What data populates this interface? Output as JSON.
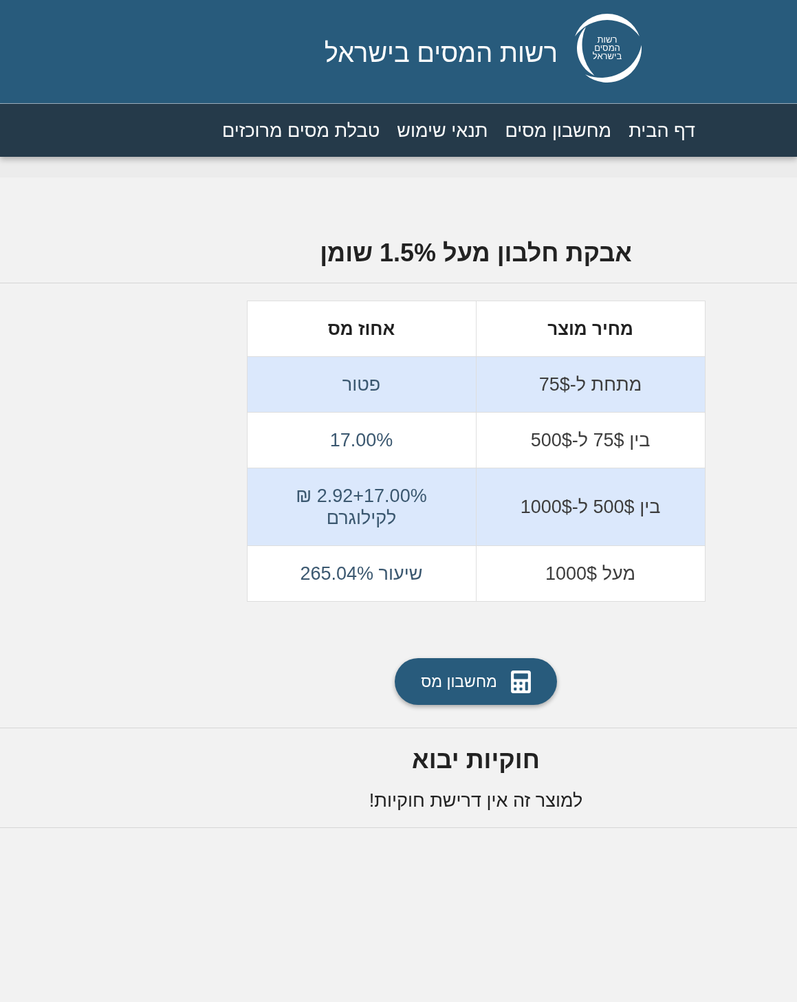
{
  "header": {
    "logo_text": [
      "רשות",
      "המסים",
      "בישראל"
    ],
    "title": "רשות המסים בישראל"
  },
  "nav": {
    "items": [
      "דף הבית",
      "מחשבון מסים",
      "תנאי שימוש",
      "טבלת מסים מרוכזים"
    ]
  },
  "product": {
    "title": "אבקת חלבון מעל 1.5% שומן",
    "table": {
      "columns": [
        "מחיר מוצר",
        "אחוז מס"
      ],
      "rows": [
        [
          "מתחת ל-75$",
          "פטור"
        ],
        [
          "בין 75$ ל-500$",
          "17.00%"
        ],
        [
          "בין 500$ ל-1000$",
          "2.92+17.00% ₪ לקילוגרם"
        ],
        [
          "מעל 1000$",
          "שיעור 265.04%"
        ]
      ]
    },
    "button": "מחשבון מס"
  },
  "import_legality": {
    "title": "חוקיות יבוא",
    "text": "למוצר זה אין דרישת חוקיות!"
  }
}
